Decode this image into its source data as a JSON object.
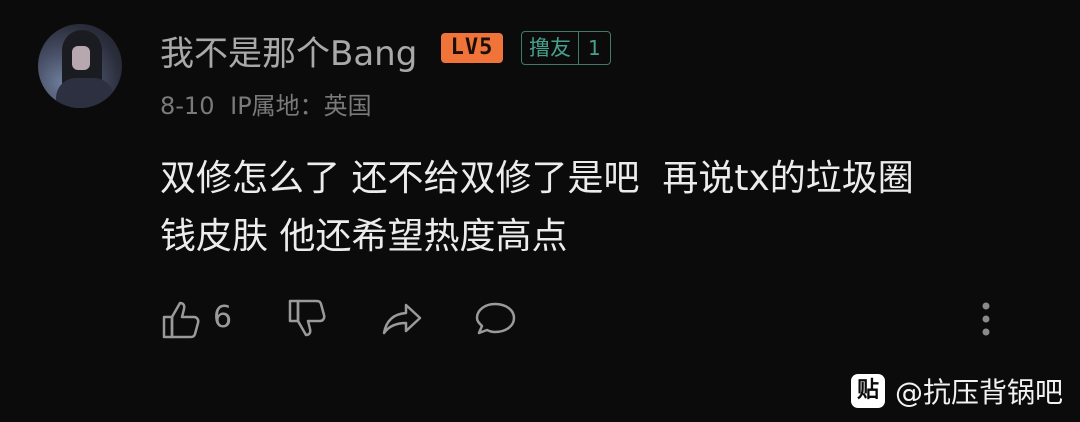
{
  "user": {
    "name": "我不是那个Bang",
    "level": "LV5",
    "friend_label": "撸友",
    "friend_count": "1"
  },
  "meta": {
    "date": "8-10",
    "ip_location": "IP属地：英国"
  },
  "comment": {
    "line1": "双修怎么了 还不给双修了是吧  再说tx的垃圾圈",
    "line2": "钱皮肤 他还希望热度高点"
  },
  "actions": {
    "like_count": "6",
    "icons": [
      "thumbs-up-icon",
      "thumbs-down-icon",
      "share-icon",
      "comment-icon",
      "more-vertical-icon"
    ]
  },
  "watermark": {
    "logo_glyph": "贴",
    "text": "@抗压背锅吧"
  },
  "colors": {
    "background": "#0b0b0c",
    "level_badge": "#f0743a",
    "friend_badge": "#47a08c"
  }
}
